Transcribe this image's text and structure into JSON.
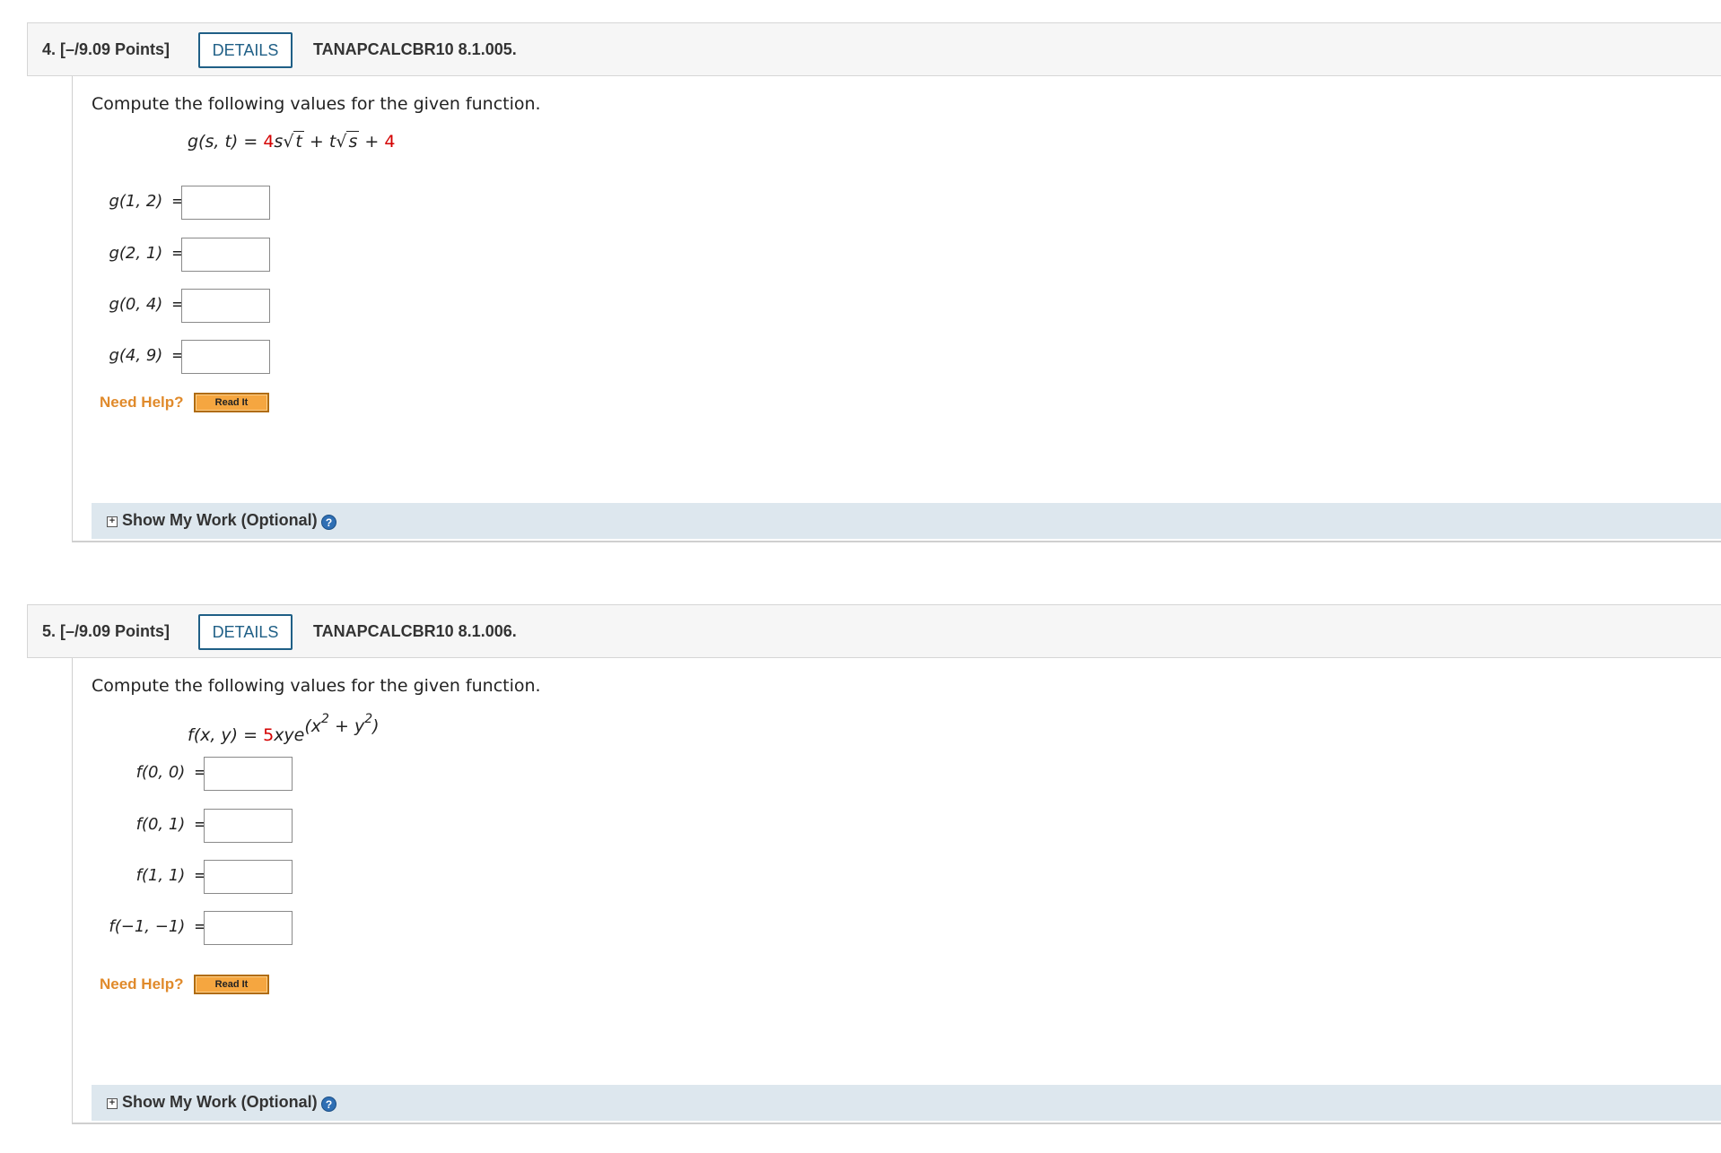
{
  "questions": [
    {
      "number": "4. [–/9.09 Points]",
      "details_label": "DETAILS",
      "code": "TANAPCALCBR10 8.1.005.",
      "prompt": "Compute the following values for the given function.",
      "function": {
        "lhs": "g(s, t) = ",
        "coef1": "4",
        "mid1": "s",
        "rad1": "t",
        "plus1": " + t",
        "rad2": "s",
        "plus2": " + ",
        "const": "4"
      },
      "rows": [
        {
          "label": "g(1, 2)",
          "eq": " = ",
          "value": ""
        },
        {
          "label": "g(2, 1)",
          "eq": " = ",
          "value": ""
        },
        {
          "label": "g(0, 4)",
          "eq": " = ",
          "value": ""
        },
        {
          "label": "g(4, 9)",
          "eq": " = ",
          "value": ""
        }
      ],
      "help_label": "Need Help?",
      "readit_label": "Read It",
      "showwork_expand": "+",
      "showwork_label": "Show My Work (Optional)",
      "showwork_help": "?"
    },
    {
      "number": "5. [–/9.09 Points]",
      "details_label": "DETAILS",
      "code": "TANAPCALCBR10 8.1.006.",
      "prompt": "Compute the following values for the given function.",
      "function": {
        "lhs": "f(x, y) = ",
        "coef1": "5",
        "mid1": "xye",
        "exp_open": "(x",
        "exp_sq1": "2",
        "exp_mid": " + y",
        "exp_sq2": "2",
        "exp_close": ")"
      },
      "rows": [
        {
          "label": "f(0, 0)",
          "eq": " = ",
          "value": ""
        },
        {
          "label": "f(0, 1)",
          "eq": " = ",
          "value": ""
        },
        {
          "label": "f(1, 1)",
          "eq": " = ",
          "value": ""
        },
        {
          "label": "f(−1, −1)",
          "eq": " = ",
          "value": ""
        }
      ],
      "help_label": "Need Help?",
      "readit_label": "Read It",
      "showwork_expand": "+",
      "showwork_label": "Show My Work (Optional)",
      "showwork_help": "?"
    }
  ],
  "colors": {
    "details_border": "#1f5f86",
    "help_text": "#e08a2b",
    "readit_bg": "#f5a640",
    "showwork_bg": "#dde7ee",
    "formula_highlight": "#d40000"
  }
}
